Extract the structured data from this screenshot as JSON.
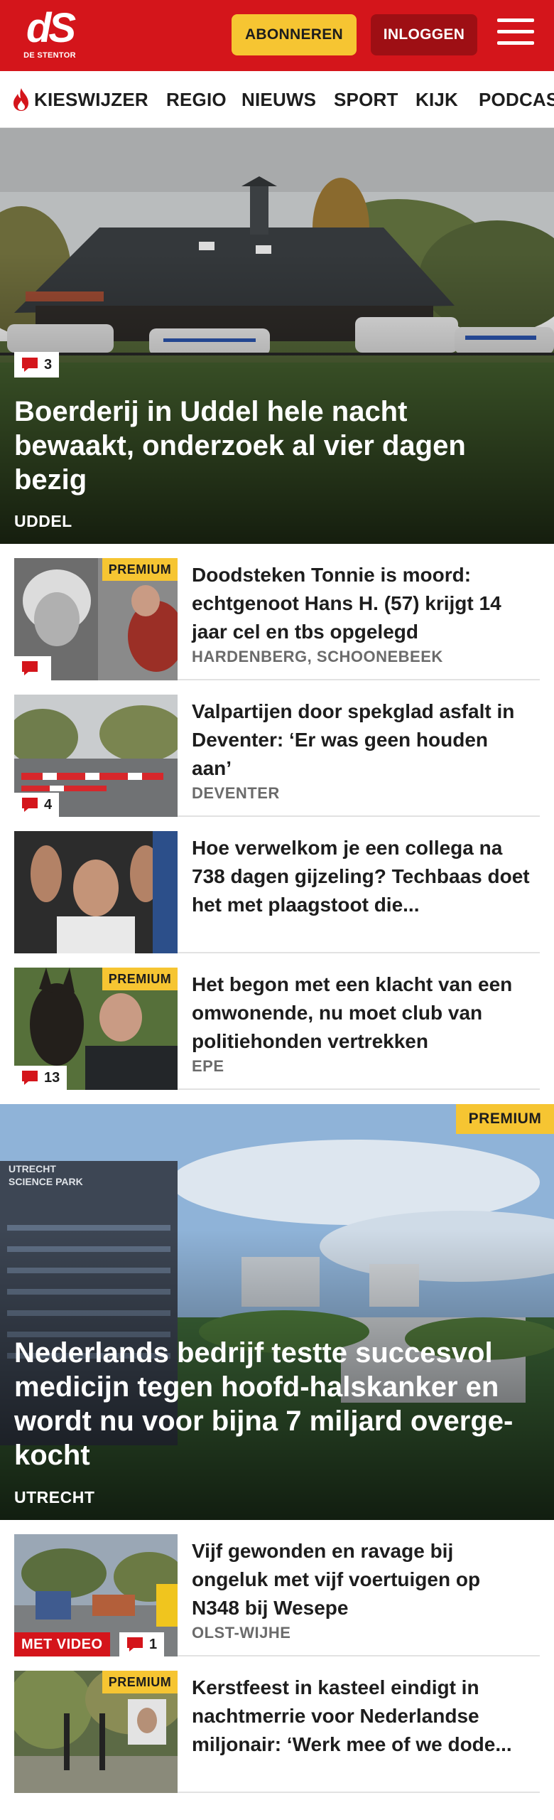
{
  "header": {
    "logo_mark": "dS",
    "logo_sub": "DE STENTOR",
    "subscribe_label": "ABONNEREN",
    "login_label": "INLOGGEN",
    "menu_icon": "hamburger-icon",
    "brand_color": "#d4151b",
    "accent_color": "#f6c532"
  },
  "nav": {
    "items": [
      {
        "label": "KIESWIJZER",
        "icon": "flame-icon"
      },
      {
        "label": "REGIO"
      },
      {
        "label": "NIEUWS"
      },
      {
        "label": "SPORT"
      },
      {
        "label": "KIJK"
      },
      {
        "label": "PODCAS"
      }
    ]
  },
  "hero1": {
    "comments": "3",
    "title": "Boerderij in Uddel hele nacht bewaakt, onderzoek al vier dagen bezig",
    "location": "UDDEL"
  },
  "articles_a": [
    {
      "premium": "PREMIUM",
      "comments": "",
      "title": "Doodsteken Tonnie is moord: echtgenoot Hans H. (57) krijgt 14 jaar cel en tbs opgelegd",
      "location": "HARDENBERG, SCHOONEBEEK"
    },
    {
      "comments": "4",
      "title": "Valpartijen door spekglad asfalt in Deventer: ‘Er was geen houden aan’",
      "location": "DEVENTER"
    },
    {
      "title": "Hoe verwelkom je een collega na 738 dagen gijzeling? Techbaas doet het met plaagstoot die...",
      "location": ""
    },
    {
      "premium": "PREMIUM",
      "comments": "13",
      "title": "Het begon met een klacht van een omwonende, nu moet club van politiehonden vertrekken",
      "location": "EPE"
    }
  ],
  "hero2": {
    "premium": "PREMIUM",
    "sign_text": "UTRECHT SCIENCE PARK",
    "title": "Nederlands bedrijf testte succesvol medicijn tegen hoofd-halskanker en wordt nu voor bijna 7 miljard overge-kocht",
    "location": "UTRECHT"
  },
  "articles_b": [
    {
      "video": "MET VIDEO",
      "comments": "1",
      "title": "Vijf gewonden en ravage bij ongeluk met vijf voertuigen op N348 bij Wesepe",
      "location": "OLST-WIJHE"
    },
    {
      "premium": "PREMIUM",
      "title": "Kerstfeest in kasteel eindigt in nachtmerrie voor Nederlandse miljonair: ‘Werk mee of we dode...",
      "location": ""
    }
  ]
}
